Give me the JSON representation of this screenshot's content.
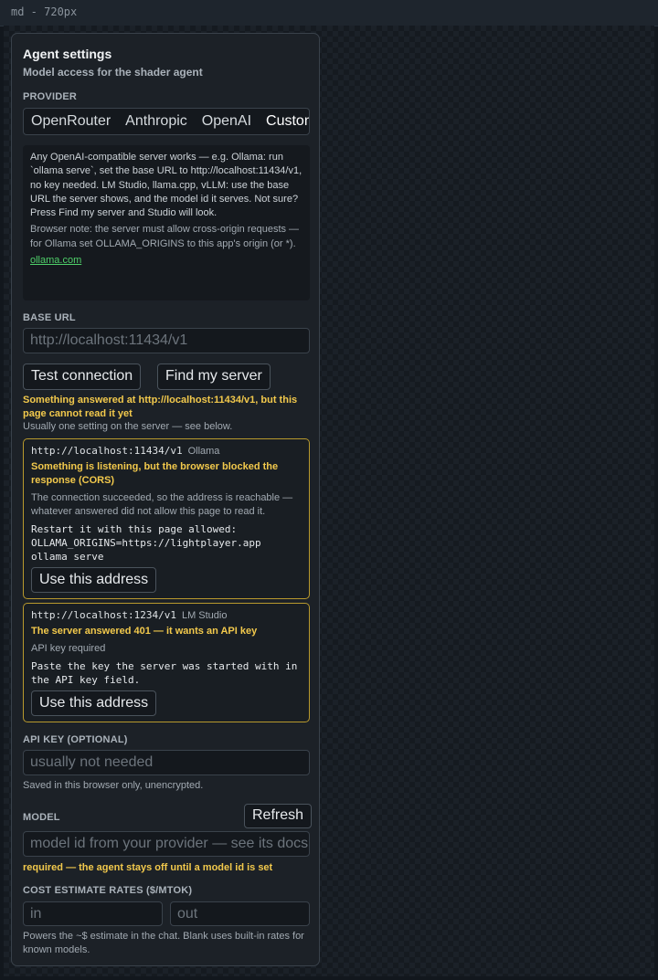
{
  "viewport_label": "md - 720px",
  "panel": {
    "title": "Agent settings",
    "subtitle": "Model access for the shader agent"
  },
  "provider": {
    "label": "PROVIDER",
    "tabs": [
      "OpenRouter",
      "Anthropic",
      "OpenAI",
      "Custom"
    ],
    "selected": "Custom"
  },
  "info": {
    "text": "Any OpenAI-compatible server works — e.g. Ollama: run `ollama serve`, set the base URL to http://localhost:11434/v1, no key needed. LM Studio, llama.cpp, vLLM: use the base URL the server shows, and the model id it serves. Not sure? Press Find my server and Studio will look.",
    "note": "Browser note: the server must allow cross-origin requests — for Ollama set OLLAMA_ORIGINS to this app's origin (or *).",
    "link": "ollama.com"
  },
  "base_url": {
    "label": "BASE URL",
    "placeholder": "http://localhost:11434/v1"
  },
  "buttons": {
    "test": "Test connection",
    "find": "Find my server"
  },
  "status": {
    "warning": "Something answered at http://localhost:11434/v1, but this page cannot read it yet",
    "hint": "Usually one setting on the server — see below."
  },
  "candidates": [
    {
      "url": "http://localhost:11434/v1",
      "server": "Ollama",
      "warning": "Something is listening, but the browser blocked the response (CORS)",
      "detail": "The connection succeeded, so the address is reachable — whatever answered did not allow this page to read it.",
      "instructions": "Restart it with this page allowed:\nOLLAMA_ORIGINS=https://lightplayer.app\nollama serve",
      "button": "Use this address"
    },
    {
      "url": "http://localhost:1234/v1",
      "server": "LM Studio",
      "warning": "The server answered 401 — it wants an API key",
      "detail": "API key required",
      "instructions": "Paste the key the server was started with in the API key field.",
      "button": "Use this address"
    }
  ],
  "api_key": {
    "label": "API KEY (OPTIONAL)",
    "placeholder": "usually not needed",
    "hint": "Saved in this browser only, unencrypted."
  },
  "model": {
    "label": "MODEL",
    "refresh": "Refresh",
    "placeholder": "model id from your provider — see its docs",
    "warning": "required — the agent stays off until a model id is set"
  },
  "cost": {
    "label": "COST ESTIMATE RATES ($/MTOK)",
    "in_placeholder": "in",
    "out_placeholder": "out",
    "hint": "Powers the ~$ estimate in the chat. Blank uses built-in rates for known models."
  }
}
